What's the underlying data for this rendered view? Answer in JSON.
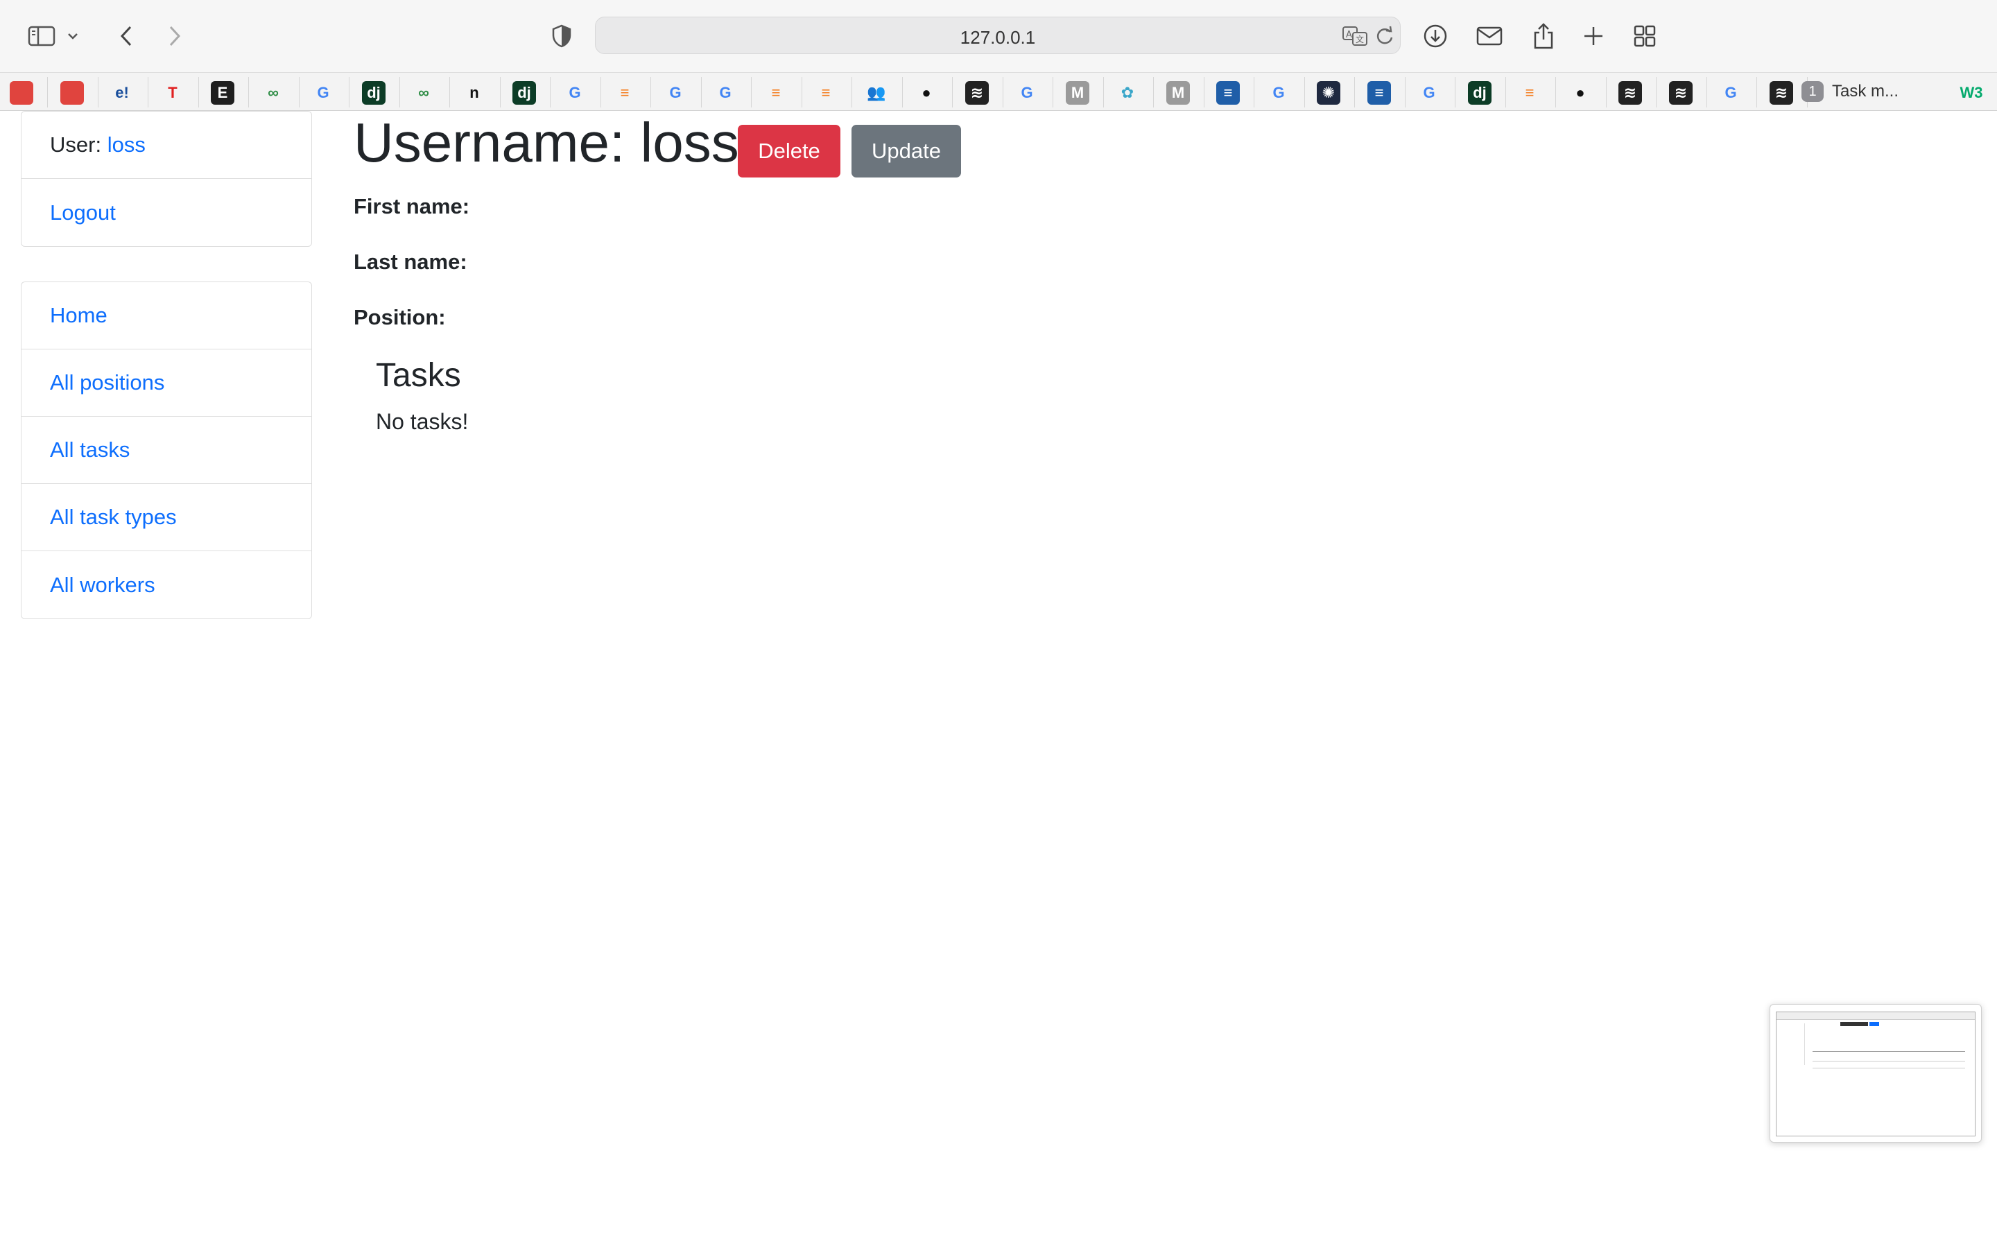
{
  "browser": {
    "url": "127.0.0.1",
    "tab": {
      "count": "1",
      "label": "Task m..."
    }
  },
  "favorites": [
    {
      "icon": "openai-icon",
      "text": "",
      "bg": "#e0443e",
      "fg": "#fff"
    },
    {
      "icon": "openai-icon",
      "text": "",
      "bg": "#e0443e",
      "fg": "#fff"
    },
    {
      "icon": "e-icon",
      "text": "e!",
      "bg": "#f3f3f3",
      "fg": "#1a4f9c"
    },
    {
      "icon": "t-icon",
      "text": "T",
      "bg": "#f3f3f3",
      "fg": "#e02020"
    },
    {
      "icon": "e-icon",
      "text": "E",
      "bg": "#1f1f1f",
      "fg": "#fff"
    },
    {
      "icon": "geeks-icon",
      "text": "∞",
      "bg": "#f3f3f3",
      "fg": "#2f8d46"
    },
    {
      "icon": "google-icon",
      "text": "G",
      "bg": "#f3f3f3",
      "fg": "#4285f4"
    },
    {
      "icon": "django-icon",
      "text": "dj",
      "bg": "#0c3c26",
      "fg": "#fff"
    },
    {
      "icon": "geeks-icon",
      "text": "∞",
      "bg": "#f3f3f3",
      "fg": "#2f8d46"
    },
    {
      "icon": "n-icon",
      "text": "n",
      "bg": "#f3f3f3",
      "fg": "#111"
    },
    {
      "icon": "django-icon",
      "text": "dj",
      "bg": "#0c3c26",
      "fg": "#fff"
    },
    {
      "icon": "google-icon",
      "text": "G",
      "bg": "#f3f3f3",
      "fg": "#4285f4"
    },
    {
      "icon": "stackoverflow-icon",
      "text": "≡",
      "bg": "#f3f3f3",
      "fg": "#f48024"
    },
    {
      "icon": "google-icon",
      "text": "G",
      "bg": "#f3f3f3",
      "fg": "#4285f4"
    },
    {
      "icon": "google-icon",
      "text": "G",
      "bg": "#f3f3f3",
      "fg": "#4285f4"
    },
    {
      "icon": "stackoverflow-icon",
      "text": "≡",
      "bg": "#f3f3f3",
      "fg": "#f48024"
    },
    {
      "icon": "stackoverflow-icon",
      "text": "≡",
      "bg": "#f3f3f3",
      "fg": "#f48024"
    },
    {
      "icon": "people-icon",
      "text": "👥",
      "bg": "#f3f3f3",
      "fg": "#3b6fd8"
    },
    {
      "icon": "github-icon",
      "text": "●",
      "bg": "#f3f3f3",
      "fg": "#111"
    },
    {
      "icon": "notion-icon",
      "text": "≋",
      "bg": "#222",
      "fg": "#fff"
    },
    {
      "icon": "google-icon",
      "text": "G",
      "bg": "#f3f3f3",
      "fg": "#4285f4"
    },
    {
      "icon": "m-icon",
      "text": "M",
      "bg": "#9a9a9a",
      "fg": "#fff"
    },
    {
      "icon": "gear-icon",
      "text": "✿",
      "bg": "#f3f3f3",
      "fg": "#39a6c9"
    },
    {
      "icon": "m-icon",
      "text": "M",
      "bg": "#9a9a9a",
      "fg": "#fff"
    },
    {
      "icon": "stackoverflow-icon",
      "text": "≡",
      "bg": "#1f5ea8",
      "fg": "#fff"
    },
    {
      "icon": "google-icon",
      "text": "G",
      "bg": "#f3f3f3",
      "fg": "#4285f4"
    },
    {
      "icon": "openai-icon",
      "text": "✺",
      "bg": "#1f2940",
      "fg": "#fff"
    },
    {
      "icon": "stackoverflow-icon",
      "text": "≡",
      "bg": "#1f5ea8",
      "fg": "#fff"
    },
    {
      "icon": "google-icon",
      "text": "G",
      "bg": "#f3f3f3",
      "fg": "#4285f4"
    },
    {
      "icon": "django-icon",
      "text": "dj",
      "bg": "#0c3c26",
      "fg": "#fff"
    },
    {
      "icon": "stackoverflow-icon",
      "text": "≡",
      "bg": "#f3f3f3",
      "fg": "#f48024"
    },
    {
      "icon": "github-icon",
      "text": "●",
      "bg": "#f3f3f3",
      "fg": "#111"
    },
    {
      "icon": "notion-icon",
      "text": "≋",
      "bg": "#222",
      "fg": "#fff"
    },
    {
      "icon": "notion-icon",
      "text": "≋",
      "bg": "#222",
      "fg": "#fff"
    },
    {
      "icon": "google-icon",
      "text": "G",
      "bg": "#f3f3f3",
      "fg": "#4285f4"
    },
    {
      "icon": "notion-icon",
      "text": "≋",
      "bg": "#222",
      "fg": "#fff"
    }
  ],
  "w3": {
    "text": "W3",
    "fg": "#04aa6d"
  },
  "sidebar": {
    "user_label": "User: ",
    "user_name": "loss",
    "logout": "Logout",
    "nav": [
      "Home",
      "All positions",
      "All tasks",
      "All task types",
      "All workers"
    ]
  },
  "main": {
    "title": "Username: loss",
    "delete_label": "Delete",
    "update_label": "Update",
    "first_name_label": "First name:",
    "last_name_label": "Last name:",
    "position_label": "Position:",
    "tasks_heading": "Tasks",
    "tasks_empty": "No tasks!"
  },
  "colors": {
    "link": "#0d6efd",
    "danger": "#dc3545",
    "secondary": "#6c757d"
  }
}
